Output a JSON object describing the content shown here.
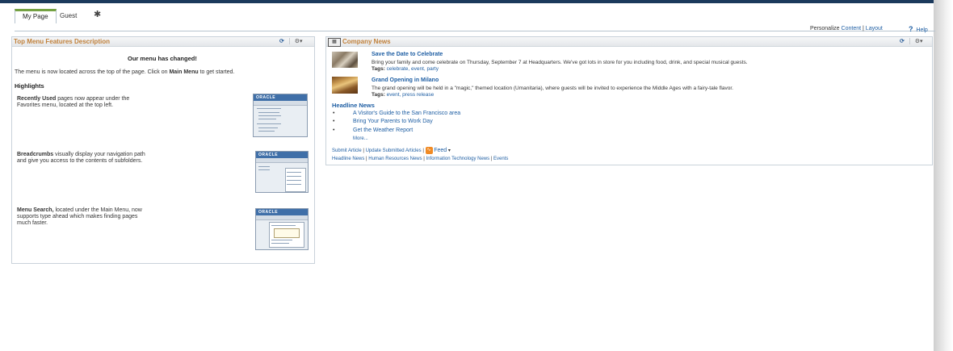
{
  "tabs": {
    "my_page": "My Page",
    "guest": "Guest",
    "settings_icon": "gear-icon"
  },
  "toplinks": {
    "personalize": "Personalize",
    "content": "Content",
    "sep": "|",
    "layout": "Layout",
    "help": "Help",
    "help_icon": "?"
  },
  "left_pagelet": {
    "title": "Top Menu Features Description",
    "heading": "Our menu has changed!",
    "intro_pre": "The menu is now located across the top of the page. Click on ",
    "intro_bold": "Main Menu",
    "intro_post": " to get started.",
    "highlights": "Highlights",
    "features": [
      {
        "bold": "Recently Used",
        "line1": " pages now appear under the",
        "line2": "Favorites menu, located at the top left.",
        "line3": ""
      },
      {
        "bold": "Breadcrumbs",
        "line1": " visually display your navigation path",
        "line2": "and give you access to the contents of subfolders.",
        "line3": ""
      },
      {
        "bold": "Menu Search,",
        "line1": " located under the Main Menu, now",
        "line2": "supports type ahead which makes finding pages",
        "line3": "much faster."
      }
    ],
    "thumb_brand": "ORACLE"
  },
  "right_pagelet": {
    "title": "Company News",
    "news": [
      {
        "title": "Save the Date to Celebrate",
        "body": "Bring your family and come celebrate on Thursday, September 7 at Headquarters. We've got lots in store for you including food, drink, and special musical guests.",
        "tags_label": "Tags:",
        "tags": "celebrate, event, party"
      },
      {
        "title": "Grand Opening in Milano",
        "body": "The grand opening will be held in a \"magic,\" themed location (Umanitaria), where guests will be invited to experience the Middle Ages with a fairy-tale flavor.",
        "tags_label": "Tags:",
        "tags": "event, press release"
      }
    ],
    "headline_heading": "Headline News",
    "headlines": [
      "A Visitor's Guide to the San Francisco area",
      "Bring Your Parents to Work Day",
      "Get the Weather Report"
    ],
    "more": "More...",
    "footer1": {
      "submit": "Submit Article",
      "sep": "|",
      "update": "Update Submitted Articles",
      "feed": "Feed"
    },
    "footer2": {
      "headline": "Headline News",
      "hr": "Human Resources News",
      "it": "Information Technology News",
      "events": "Events",
      "sep": "|"
    }
  }
}
